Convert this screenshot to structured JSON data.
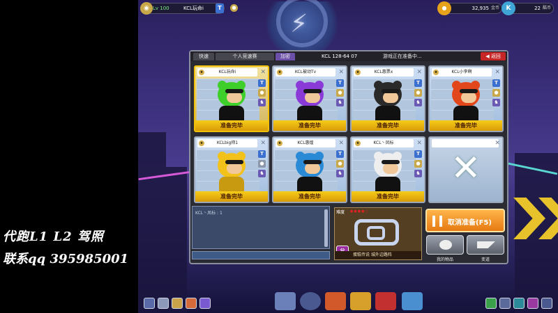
{
  "player": {
    "level": "Lv 100",
    "name": "KCL玩命i",
    "avatar_icon": "avatar-icon"
  },
  "currency": {
    "gold_value": "32,935",
    "gold_unit": "金币",
    "kc_value": "22",
    "kc_unit": "酷币"
  },
  "panel": {
    "tabs": [
      {
        "label": "快速"
      },
      {
        "label": "个人竞速赛"
      },
      {
        "label": "加密"
      }
    ],
    "room_id": "KCL 128-64 07",
    "status": "游戏正在准备中...",
    "return_label": "返回"
  },
  "slots": [
    {
      "name": "KCL玩命i",
      "ready": "准备完毕",
      "color": "#3fcf2a"
    },
    {
      "name": "KCL被动Tv",
      "ready": "准备完毕",
      "color": "#8a3ad6"
    },
    {
      "name": "KCL惠票x",
      "ready": "准备完毕",
      "color": "#2a2a2a"
    },
    {
      "name": "KCL小李啊",
      "ready": "准备完毕",
      "color": "#e2461b"
    },
    {
      "name": "KCLbig帅1",
      "ready": "准备完毕",
      "color": "#f2c21a"
    },
    {
      "name": "KCL惠煌",
      "ready": "准备完毕",
      "color": "#2a8ad6"
    },
    {
      "name": "KCL丶凤标",
      "ready": "准备完毕",
      "color": "#eeeeee"
    },
    {
      "name": "",
      "ready": "",
      "color": "#cfd9e8"
    }
  ],
  "chat": {
    "line": "KCL丶凤标 : 1"
  },
  "map": {
    "difficulty_label": "难度",
    "name": "蛋糕传说 城外边路阵"
  },
  "actions": {
    "cancel_label": "取消准备(F5)",
    "items_label": "我的物品",
    "change_label": "变道"
  },
  "promo": {
    "line1": "代跑L1 L2 驾照",
    "line2": "联系qq 395985001"
  },
  "colors": {
    "ready_bar": "#f6cc1a",
    "cancel_button": "#ff9a2e",
    "return_button": "#c72626",
    "active_tab": "#6b4fa8"
  }
}
